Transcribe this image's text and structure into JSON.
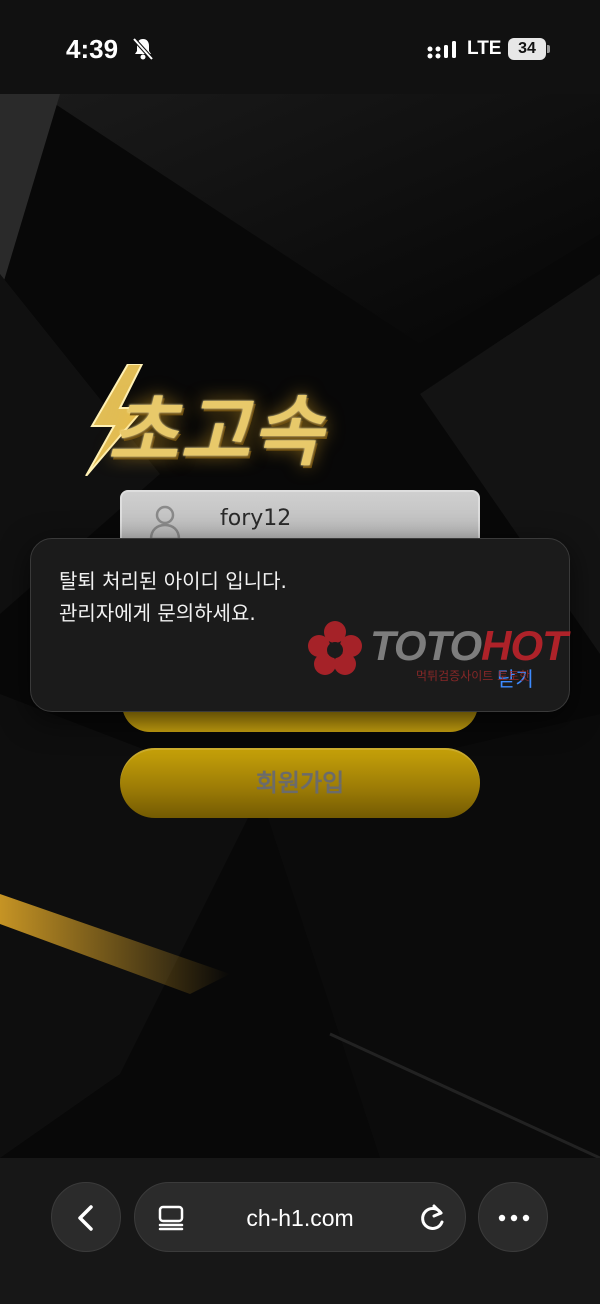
{
  "status_bar": {
    "time": "4:39",
    "network": "LTE",
    "battery": "34"
  },
  "login": {
    "logo_text": "초고속",
    "id_value": "fory12",
    "signup_label": "회원가입"
  },
  "alert": {
    "message_line1": "탈퇴 처리된 아이디 입니다.",
    "message_line2": "관리자에게 문의하세요.",
    "close_label": "닫기"
  },
  "watermark": {
    "brand_part1": "TOTO",
    "brand_part2": "HOT",
    "subtitle": "먹튀검증사이트 토토핫"
  },
  "browser": {
    "url": "ch-h1.com"
  },
  "colors": {
    "accent_gold": "#c9a310",
    "link_blue": "#3d8bff",
    "watermark_red": "#c8242c"
  }
}
